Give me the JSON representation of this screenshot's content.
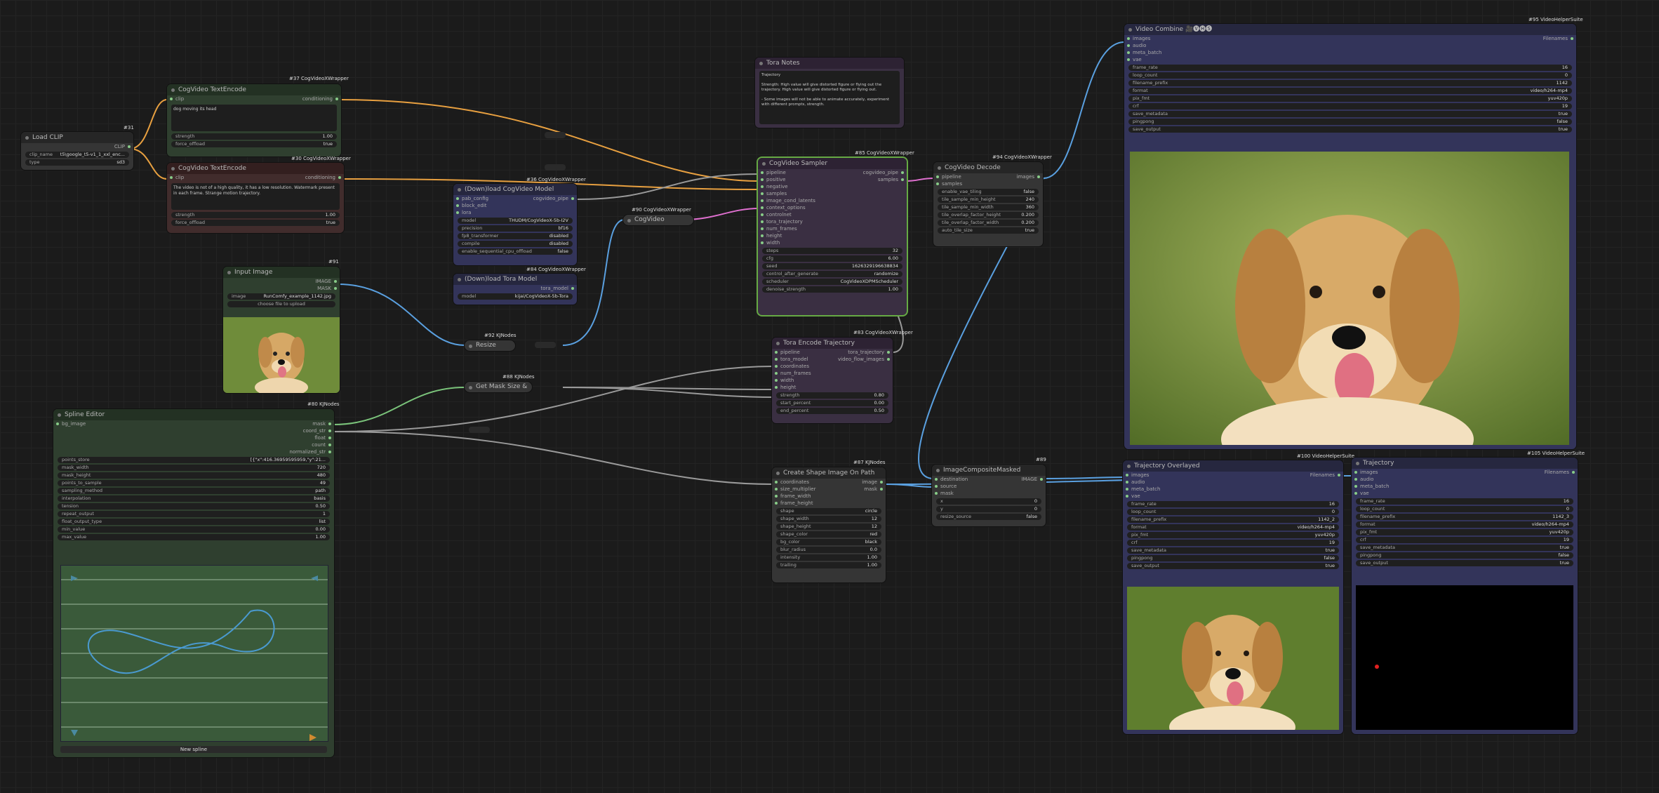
{
  "nodes": {
    "load_clip": {
      "title": "Load CLIP",
      "tag": "#31",
      "w1_label": "clip_name",
      "w1_value": "t5\\google_t5-v1_1_xxl_enc...",
      "w2_label": "type",
      "w2_value": "sd3",
      "out": "CLIP"
    },
    "text_pos": {
      "title": "CogVideo TextEncode",
      "tag": "#37 CogVideoXWrapper",
      "slot": "clip",
      "out": "conditioning",
      "text": "dog moving its head",
      "strength_label": "strength",
      "strength": "1.00",
      "offload_label": "force_offload",
      "offload": "true"
    },
    "text_neg": {
      "title": "CogVideo TextEncode",
      "tag": "#30 CogVideoXWrapper",
      "slot": "clip",
      "out": "conditioning",
      "text": "The video is not of a high quality, it has a low resolution. Watermark present in each frame. Strange motion trajectory.",
      "strength_label": "strength",
      "strength": "1.00",
      "offload_label": "force_offload",
      "offload": "true"
    },
    "dl_model": {
      "title": "(Down)load CogVideo Model",
      "tag": "#36 CogVideoXWrapper",
      "slots": [
        "pab_config",
        "block_edit",
        "lora"
      ],
      "out": "cogvideo_pipe",
      "widgets": [
        [
          "model",
          "THUDM/CogVideoX-5b-I2V"
        ],
        [
          "precision",
          "bf16"
        ],
        [
          "fp8_transformer",
          "disabled"
        ],
        [
          "compile",
          "disabled"
        ],
        [
          "enable_sequential_cpu_offload",
          "false"
        ]
      ]
    },
    "dl_tora": {
      "title": "(Down)load Tora Model",
      "tag": "#84 CogVideoXWrapper",
      "out": "tora_model",
      "w_label": "model",
      "w_value": "kijai/CogVideoX-5b-Tora"
    },
    "tora_notes": {
      "title": "Tora Notes",
      "text": "Trajectory\n\nStrength: High value will give distorted figure or flying out the trajectory. High value will give distorted figure or flying out.\n\n- Some images will not be able to animate accurately, experiment with different prompts, strength."
    },
    "image_encode": {
      "title": "CogVideo ImageEncode",
      "tag": "#90 CogVideoXWrapper"
    },
    "sampler": {
      "title": "CogVideo Sampler",
      "tag": "#85 CogVideoXWrapper",
      "slots": [
        "pipeline",
        "positive",
        "negative",
        "samples",
        "image_cond_latents",
        "context_options",
        "controlnet",
        "tora_trajectory",
        "num_frames",
        "height",
        "width"
      ],
      "outs": [
        "cogvideo_pipe",
        "samples"
      ],
      "widgets": [
        [
          "steps",
          "32"
        ],
        [
          "cfg",
          "6.00"
        ],
        [
          "seed",
          "1626329196638834"
        ],
        [
          "control_after_generate",
          "randomize"
        ],
        [
          "scheduler",
          "CogVideoXDPMScheduler"
        ],
        [
          "denoise_strength",
          "1.00"
        ]
      ]
    },
    "decode": {
      "title": "CogVideo Decode",
      "tag": "#94 CogVideoXWrapper",
      "slots": [
        "pipeline",
        "samples"
      ],
      "out": "images",
      "widgets": [
        [
          "enable_vae_tiling",
          "false"
        ],
        [
          "tile_sample_min_height",
          "240"
        ],
        [
          "tile_sample_min_width",
          "360"
        ],
        [
          "tile_overlap_factor_height",
          "0.200"
        ],
        [
          "tile_overlap_factor_width",
          "0.200"
        ],
        [
          "auto_tile_size",
          "true"
        ]
      ]
    },
    "input_image": {
      "title": "Input Image",
      "tag": "#91",
      "outs": [
        "IMAGE",
        "MASK"
      ],
      "w_label": "image",
      "w_value": "RunComfy_example_1142.jpg",
      "upload": "choose file to upload"
    },
    "resize": {
      "title": "Resize Image",
      "tag": "#92 KJNodes"
    },
    "mask_size": {
      "title": "Get Mask Size & Count",
      "tag": "#88 KJNodes"
    },
    "spline": {
      "title": "Spline Editor",
      "tag": "#80 KJNodes",
      "slot": "bg_image",
      "outs": [
        "mask",
        "coord_str",
        "float",
        "count",
        "normalized_str"
      ],
      "widgets": [
        [
          "points_store",
          "[{\"x\":416.36959595959,\"y\":21..."
        ],
        [
          "mask_width",
          "720"
        ],
        [
          "mask_height",
          "480"
        ],
        [
          "points_to_sample",
          "49"
        ],
        [
          "sampling_method",
          "path"
        ],
        [
          "interpolation",
          "basis"
        ],
        [
          "tension",
          "0.50"
        ],
        [
          "repeat_output",
          "1"
        ],
        [
          "float_output_type",
          "list"
        ],
        [
          "min_value",
          "0.00"
        ],
        [
          "max_value",
          "1.00"
        ]
      ],
      "button": "New spline"
    },
    "tora_encode": {
      "title": "Tora Encode Trajectory",
      "tag": "#83 CogVideoXWrapper",
      "slots": [
        "pipeline",
        "tora_model",
        "coordinates",
        "num_frames",
        "width",
        "height"
      ],
      "outs": [
        "tora_trajectory",
        "video_flow_images"
      ],
      "widgets": [
        [
          "strength",
          "0.80"
        ],
        [
          "start_percent",
          "0.00"
        ],
        [
          "end_percent",
          "0.50"
        ]
      ]
    },
    "shape": {
      "title": "Create Shape Image On Path",
      "tag": "#87 KJNodes",
      "slots": [
        "coordinates",
        "size_multiplier",
        "frame_width",
        "frame_height"
      ],
      "outs": [
        "image",
        "mask"
      ],
      "widgets": [
        [
          "shape",
          "circle"
        ],
        [
          "shape_width",
          "12"
        ],
        [
          "shape_height",
          "12"
        ],
        [
          "shape_color",
          "red"
        ],
        [
          "bg_color",
          "black"
        ],
        [
          "blur_radius",
          "0.0"
        ],
        [
          "intensity",
          "1.00"
        ],
        [
          "trailing",
          "1.00"
        ]
      ]
    },
    "composite": {
      "title": "ImageCompositeMasked",
      "tag": "#89",
      "slots": [
        "destination",
        "source",
        "mask"
      ],
      "out": "IMAGE",
      "widgets": [
        [
          "x",
          "0"
        ],
        [
          "y",
          "0"
        ],
        [
          "resize_source",
          "false"
        ]
      ]
    },
    "combine_main": {
      "title": "Video Combine 🎥🅥🅗🅢",
      "tag": "#95 VideoHelperSuite",
      "slots": [
        "images",
        "audio",
        "meta_batch",
        "vae"
      ],
      "out": "Filenames",
      "widgets": [
        [
          "frame_rate",
          "16"
        ],
        [
          "loop_count",
          "0"
        ],
        [
          "filename_prefix",
          "1142"
        ],
        [
          "format",
          "video/h264-mp4"
        ],
        [
          "pix_fmt",
          "yuv420p"
        ],
        [
          "crf",
          "19"
        ],
        [
          "save_metadata",
          "true"
        ],
        [
          "pingpong",
          "false"
        ],
        [
          "save_output",
          "true"
        ]
      ]
    },
    "combine_overlay": {
      "title": "Trajectory Overlayed",
      "tag": "#100 VideoHelperSuite",
      "slots": [
        "images",
        "audio",
        "meta_batch",
        "vae"
      ],
      "out": "Filenames",
      "widgets": [
        [
          "frame_rate",
          "16"
        ],
        [
          "loop_count",
          "0"
        ],
        [
          "filename_prefix",
          "1142_2"
        ],
        [
          "format",
          "video/h264-mp4"
        ],
        [
          "pix_fmt",
          "yuv420p"
        ],
        [
          "crf",
          "19"
        ],
        [
          "save_metadata",
          "true"
        ],
        [
          "pingpong",
          "false"
        ],
        [
          "save_output",
          "true"
        ]
      ]
    },
    "combine_traj": {
      "title": "Trajectory",
      "tag": "#105 VideoHelperSuite",
      "slots": [
        "images",
        "audio",
        "meta_batch",
        "vae"
      ],
      "out": "Filenames",
      "widgets": [
        [
          "frame_rate",
          "16"
        ],
        [
          "loop_count",
          "0"
        ],
        [
          "filename_prefix",
          "1142_3"
        ],
        [
          "format",
          "video/h264-mp4"
        ],
        [
          "pix_fmt",
          "yuv420p"
        ],
        [
          "crf",
          "19"
        ],
        [
          "save_metadata",
          "true"
        ],
        [
          "pingpong",
          "false"
        ],
        [
          "save_output",
          "true"
        ]
      ]
    }
  },
  "colors": {
    "wire_orange": "#e8a040",
    "wire_blue": "#5aa0e0",
    "wire_gray": "#9a9a9a",
    "wire_pink": "#e070d0",
    "wire_green": "#7bc47b"
  }
}
